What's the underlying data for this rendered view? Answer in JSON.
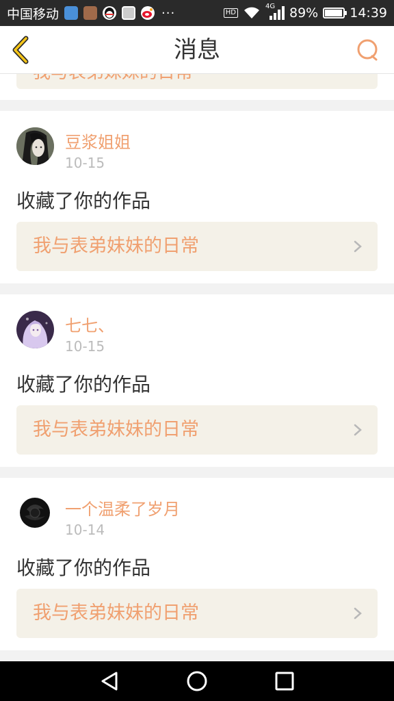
{
  "status_bar": {
    "carrier": "中国移动",
    "more": "···",
    "network": "4G",
    "battery_text": "89%",
    "battery_level": 0.89,
    "time": "14:39",
    "hd": "HD"
  },
  "header": {
    "title": "消息",
    "back_icon": "chevron-left-icon",
    "search_icon": "search-icon",
    "accent_color": "#f0a070"
  },
  "messages": [
    {
      "username": "豆浆姐姐",
      "date": "10-15",
      "action": "收藏了你的作品",
      "work_title": "我与表弟妹妹的日常"
    },
    {
      "username": "七七、",
      "date": "10-15",
      "action": "收藏了你的作品",
      "work_title": "我与表弟妹妹的日常"
    },
    {
      "username": "一个温柔了岁月",
      "date": "10-14",
      "action": "收藏了你的作品",
      "work_title": "我与表弟妹妹的日常"
    }
  ],
  "partial_item": {
    "work_title": "我与表弟妹妹的日常"
  },
  "nav": {
    "back_icon": "triangle-back-icon",
    "home_icon": "circle-home-icon",
    "recents_icon": "square-recents-icon"
  }
}
